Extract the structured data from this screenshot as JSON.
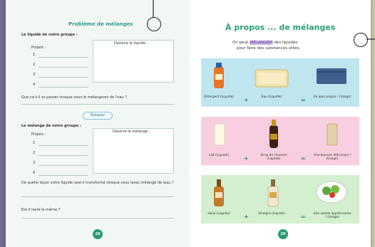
{
  "left": {
    "title": "Problème de mélanges",
    "q_liquid": "Le liquide de notre groupe :",
    "projets_label": "Projets :",
    "draw_liquid": "Dessine le liquide :",
    "nums": [
      "1",
      "2",
      "3",
      "4"
    ],
    "q_water": "Que va-t-il se passer lorsque vous le mélangerez de l'eau ?",
    "essayez": "Essayez",
    "q_mixture": "Le mélange de notre groupe :",
    "draw_mixture": "Dessine le mélange :",
    "q_transform": "De quelle façon votre liquide sest-il transformé lorsque vous lavez mélangé de leau ?",
    "q_same": "Est-il resté le même ?",
    "page_number": "28"
  },
  "right": {
    "title": "À propos ... de mélanges",
    "subtitle_pre": "On peut",
    "subtitle_hl": "MÉLANGER",
    "subtitle_post": "des liquides",
    "subtitle_line2": "pour faire des substances utiles.",
    "rows": [
      {
        "color": "#bfe6ef",
        "a": "Détergent (Liquide)",
        "b": "Eau (Liquide)",
        "c": "Un jean propre ! (Usage)"
      },
      {
        "color": "#f8cfe0",
        "a": "Lait (Liquide)",
        "b": "Sirop de chocolat (Liquide)",
        "c": "Une boisson délicieuse ! (Usage)"
      },
      {
        "color": "#d3efcf",
        "a": "Huile (Liquide)",
        "b": "Vinaigre (Liquide)",
        "c": "Une salade appétissante ! (Usage)"
      }
    ],
    "plus": "+",
    "equals": "=",
    "page_number": "29"
  }
}
